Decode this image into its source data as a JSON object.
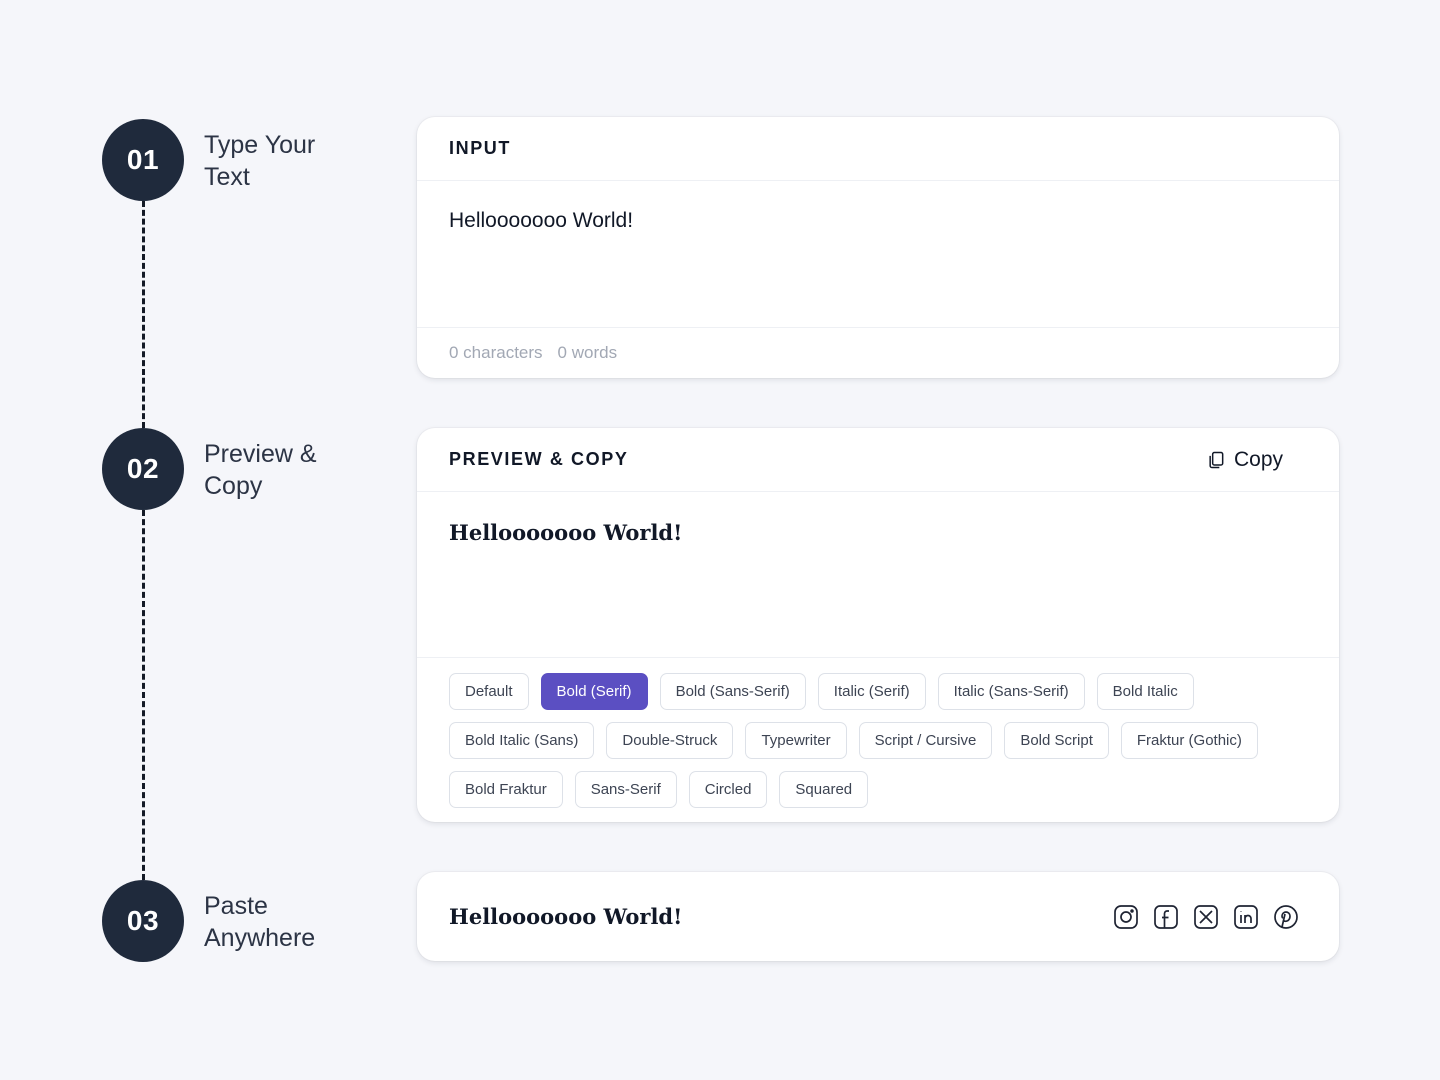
{
  "steps": [
    {
      "number": "01",
      "label": "Type Your Text"
    },
    {
      "number": "02",
      "label": "Preview & Copy"
    },
    {
      "number": "03",
      "label": "Paste Anywhere"
    }
  ],
  "input_card": {
    "title": "INPUT",
    "text": "Hellooooooo World!",
    "char_count": "0 characters",
    "word_count": "0 words"
  },
  "preview_card": {
    "title": "PREVIEW & COPY",
    "copy_label": "Copy",
    "preview_text": "Hellooooooo World!",
    "styles": [
      {
        "label": "Default",
        "active": false
      },
      {
        "label": "Bold (Serif)",
        "active": true
      },
      {
        "label": "Bold (Sans-Serif)",
        "active": false
      },
      {
        "label": "Italic (Serif)",
        "active": false
      },
      {
        "label": "Italic (Sans-Serif)",
        "active": false
      },
      {
        "label": "Bold Italic",
        "active": false
      },
      {
        "label": "Bold Italic (Sans)",
        "active": false
      },
      {
        "label": "Double-Struck",
        "active": false
      },
      {
        "label": "Typewriter",
        "active": false
      },
      {
        "label": "Script / Cursive",
        "active": false
      },
      {
        "label": "Bold Script",
        "active": false
      },
      {
        "label": "Fraktur (Gothic)",
        "active": false
      },
      {
        "label": "Bold Fraktur",
        "active": false
      },
      {
        "label": "Sans-Serif",
        "active": false
      },
      {
        "label": "Circled",
        "active": false
      },
      {
        "label": "Squared",
        "active": false
      }
    ]
  },
  "paste_card": {
    "text": "Hellooooooo World!",
    "social": [
      "instagram-icon",
      "facebook-icon",
      "x-twitter-icon",
      "linkedin-icon",
      "pinterest-icon"
    ]
  },
  "colors": {
    "accent": "#5b4fc2",
    "step_circle": "#1f2a3c",
    "background": "#f5f6fa"
  }
}
